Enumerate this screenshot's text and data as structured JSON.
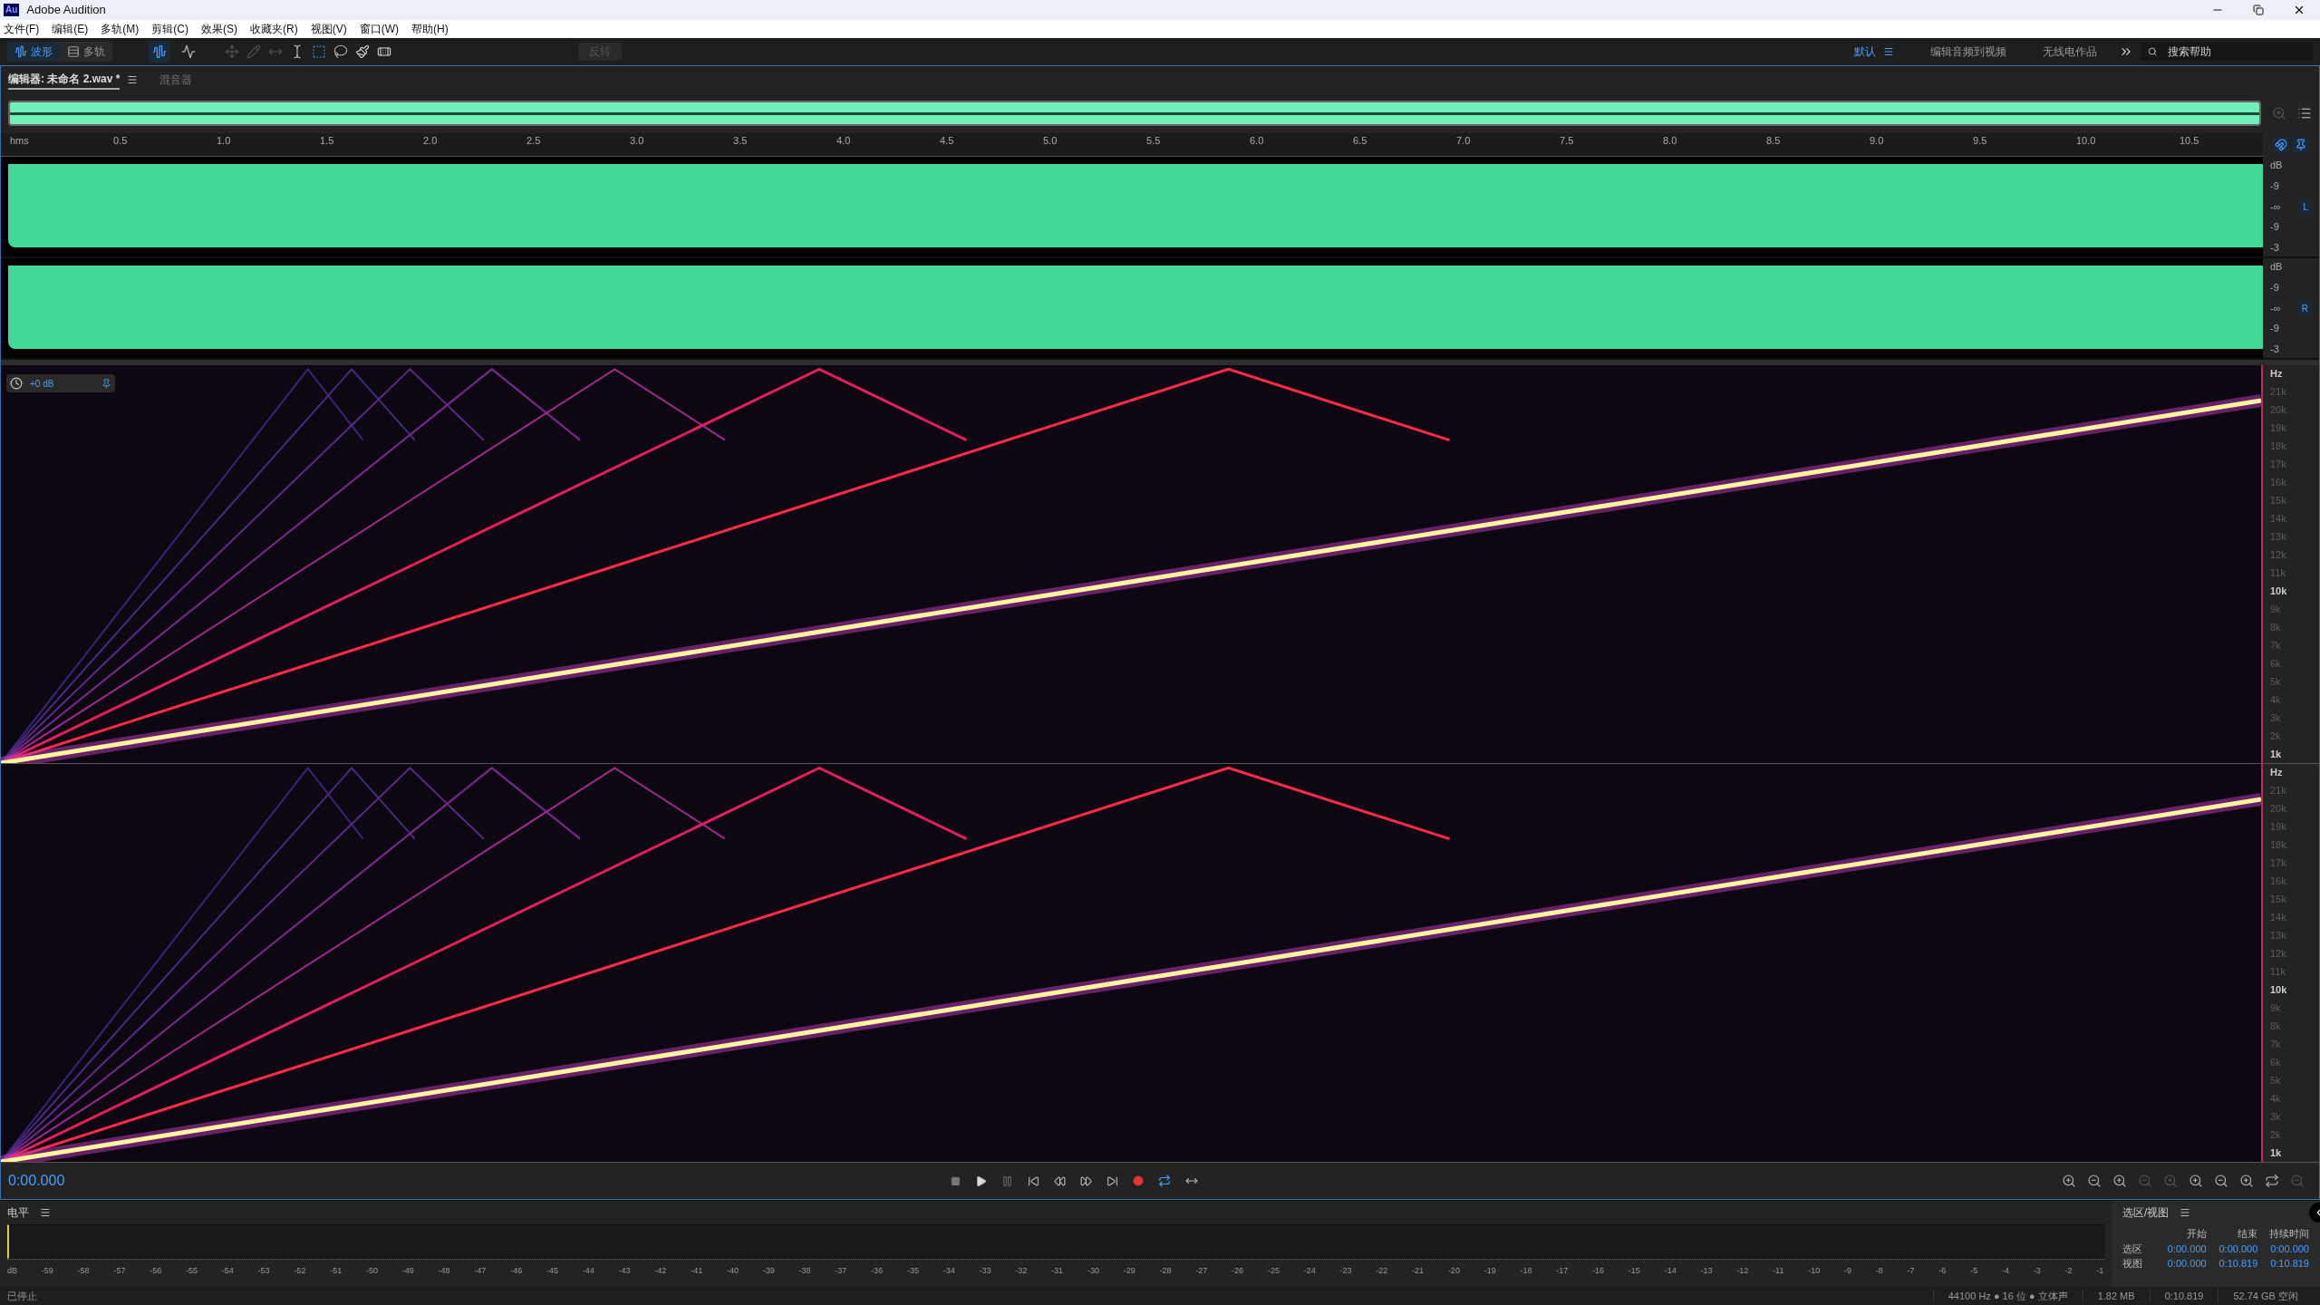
{
  "window": {
    "title": "Adobe Audition",
    "app_icon": "Au"
  },
  "menu": [
    "文件(F)",
    "编辑(E)",
    "多轨(M)",
    "剪辑(C)",
    "效果(S)",
    "收藏夹(R)",
    "视图(V)",
    "窗口(W)",
    "帮助(H)"
  ],
  "toolbar": {
    "modes": [
      {
        "label": "波形",
        "selected": true
      },
      {
        "label": "多轨",
        "selected": false
      }
    ],
    "reverse_button": "反转"
  },
  "workspaces": [
    {
      "label": "默认",
      "selected": true
    },
    {
      "label": "编辑音频到视频",
      "selected": false
    },
    {
      "label": "无线电作品",
      "selected": false
    }
  ],
  "search": {
    "placeholder": "搜索帮助"
  },
  "panel_tabs": [
    {
      "label": "编辑器: 未命名 2.wav *",
      "selected": true
    },
    {
      "label": "混音器",
      "selected": false
    }
  ],
  "ruler": [
    "hms",
    "0.5",
    "1.0",
    "1.5",
    "2.0",
    "2.5",
    "3.0",
    "3.5",
    "4.0",
    "4.5",
    "5.0",
    "5.5",
    "6.0",
    "6.5",
    "7.0",
    "7.5",
    "8.0",
    "8.5",
    "9.0",
    "9.5",
    "10.0",
    "10.5"
  ],
  "channels": [
    {
      "label": "L",
      "db_scale": [
        "dB",
        "-9",
        "-∞",
        "-9",
        "-3"
      ]
    },
    {
      "label": "R",
      "db_scale": [
        "dB",
        "-9",
        "-∞",
        "-9",
        "-3"
      ]
    }
  ],
  "spectrogram": {
    "gain": "+0 dB",
    "channels": [
      {
        "hz_scale": [
          {
            "label": "Hz",
            "major": true
          },
          {
            "label": "21k",
            "major": false
          },
          {
            "label": "20k",
            "major": false
          },
          {
            "label": "19k",
            "major": false
          },
          {
            "label": "18k",
            "major": false
          },
          {
            "label": "17k",
            "major": false
          },
          {
            "label": "16k",
            "major": false
          },
          {
            "label": "15k",
            "major": false
          },
          {
            "label": "14k",
            "major": false
          },
          {
            "label": "13k",
            "major": false
          },
          {
            "label": "12k",
            "major": false
          },
          {
            "label": "11k",
            "major": false
          },
          {
            "label": "10k",
            "major": true
          },
          {
            "label": "9k",
            "major": false
          },
          {
            "label": "8k",
            "major": false
          },
          {
            "label": "7k",
            "major": false
          },
          {
            "label": "6k",
            "major": false
          },
          {
            "label": "5k",
            "major": false
          },
          {
            "label": "4k",
            "major": false
          },
          {
            "label": "3k",
            "major": false
          },
          {
            "label": "2k",
            "major": false
          },
          {
            "label": "1k",
            "major": true
          }
        ]
      },
      {
        "hz_scale": [
          {
            "label": "Hz",
            "major": true
          },
          {
            "label": "21k",
            "major": false
          },
          {
            "label": "20k",
            "major": false
          },
          {
            "label": "19k",
            "major": false
          },
          {
            "label": "18k",
            "major": false
          },
          {
            "label": "17k",
            "major": false
          },
          {
            "label": "16k",
            "major": false
          },
          {
            "label": "15k",
            "major": false
          },
          {
            "label": "14k",
            "major": false
          },
          {
            "label": "13k",
            "major": false
          },
          {
            "label": "12k",
            "major": false
          },
          {
            "label": "11k",
            "major": false
          },
          {
            "label": "10k",
            "major": true
          },
          {
            "label": "9k",
            "major": false
          },
          {
            "label": "8k",
            "major": false
          },
          {
            "label": "7k",
            "major": false
          },
          {
            "label": "6k",
            "major": false
          },
          {
            "label": "5k",
            "major": false
          },
          {
            "label": "4k",
            "major": false
          },
          {
            "label": "3k",
            "major": false
          },
          {
            "label": "2k",
            "major": false
          },
          {
            "label": "1k",
            "major": true
          }
        ]
      }
    ]
  },
  "transport": {
    "time": "0:00.000"
  },
  "level_panel": {
    "title": "电平",
    "scale": [
      "dB",
      "-59",
      "-58",
      "-57",
      "-56",
      "-55",
      "-54",
      "-53",
      "-52",
      "-51",
      "-50",
      "-49",
      "-48",
      "-47",
      "-46",
      "-45",
      "-44",
      "-43",
      "-42",
      "-41",
      "-40",
      "-39",
      "-38",
      "-37",
      "-36",
      "-35",
      "-34",
      "-33",
      "-32",
      "-31",
      "-30",
      "-29",
      "-28",
      "-27",
      "-26",
      "-25",
      "-24",
      "-23",
      "-22",
      "-21",
      "-20",
      "-19",
      "-18",
      "-17",
      "-16",
      "-15",
      "-14",
      "-13",
      "-12",
      "-11",
      "-10",
      "-9",
      "-8",
      "-7",
      "-6",
      "-5",
      "-4",
      "-3",
      "-2",
      "-1"
    ]
  },
  "selection_panel": {
    "title": "选区/视图",
    "columns": [
      "开始",
      "结束",
      "持续时间"
    ],
    "rows": [
      {
        "label": "选区",
        "values": [
          "0:00.000",
          "0:00.000",
          "0:00.000"
        ]
      },
      {
        "label": "视图",
        "values": [
          "0:00.000",
          "0:10.819",
          "0:10.819"
        ]
      }
    ]
  },
  "status_bar": {
    "state": "已停止",
    "items": [
      "44100 Hz ● 16 位 ● 立体声",
      "1.82 MB",
      "0:10.819",
      "52.74 GB 空闲"
    ]
  }
}
